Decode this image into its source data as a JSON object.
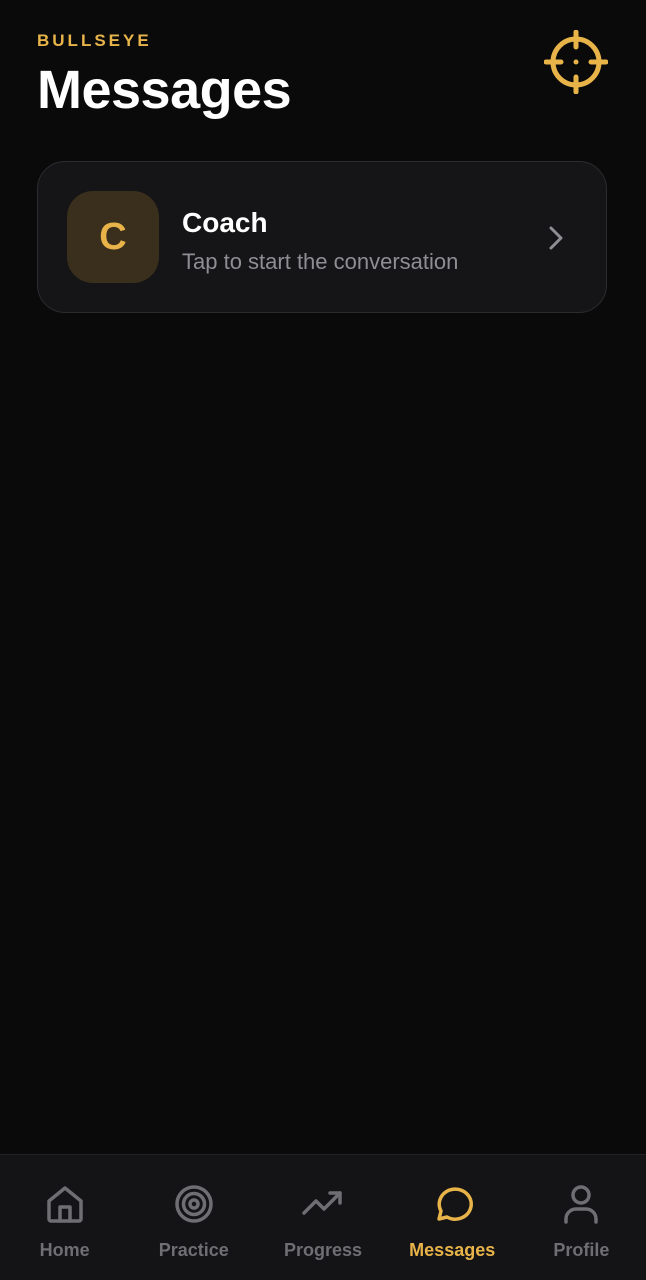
{
  "header": {
    "brand": "BULLSEYE",
    "title": "Messages"
  },
  "threads": [
    {
      "avatar_letter": "C",
      "name": "Coach",
      "preview": "Tap to start the conversation"
    }
  ],
  "tabs": [
    {
      "label": "Home",
      "icon": "home-icon",
      "active": false
    },
    {
      "label": "Practice",
      "icon": "target-icon",
      "active": false
    },
    {
      "label": "Progress",
      "icon": "trending-up-icon",
      "active": false
    },
    {
      "label": "Messages",
      "icon": "chat-bubble-icon",
      "active": true
    },
    {
      "label": "Profile",
      "icon": "user-icon",
      "active": false
    }
  ],
  "colors": {
    "accent": "#e8b44a",
    "background": "#0a0a0a",
    "card": "#151517",
    "inactive": "#6e6e73"
  }
}
